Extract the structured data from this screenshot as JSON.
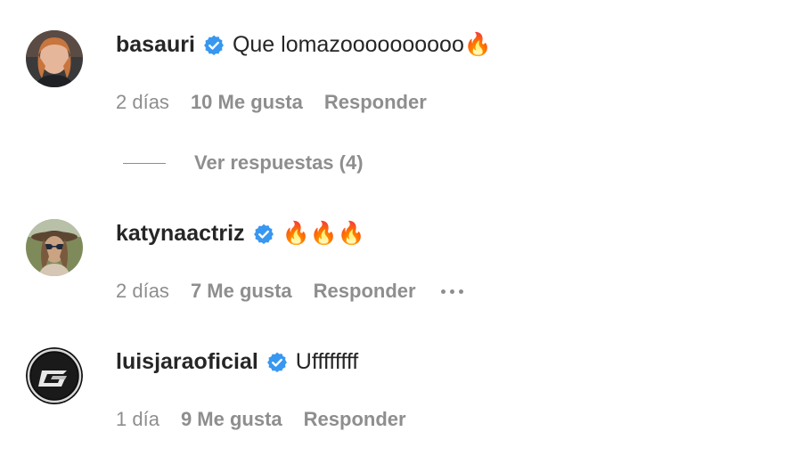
{
  "comments": [
    {
      "username": "basauri",
      "text": "Que lomazoooooooooo🔥",
      "time": "2 días",
      "likes": "10 Me gusta",
      "reply": "Responder"
    },
    {
      "username": "katynaactriz",
      "text": "🔥🔥🔥",
      "time": "2 días",
      "likes": "7 Me gusta",
      "reply": "Responder"
    },
    {
      "username": "luisjaraoficial",
      "text": "Uffffffff",
      "time": "1 día",
      "likes": "9 Me gusta",
      "reply": "Responder"
    }
  ],
  "view_replies": "Ver respuestas (4)",
  "icons": {
    "verified": "verified-badge-icon",
    "more": "more-options-icon"
  },
  "colors": {
    "text": "#262626",
    "secondary": "#8e8e8e",
    "verified": "#3897f0"
  }
}
